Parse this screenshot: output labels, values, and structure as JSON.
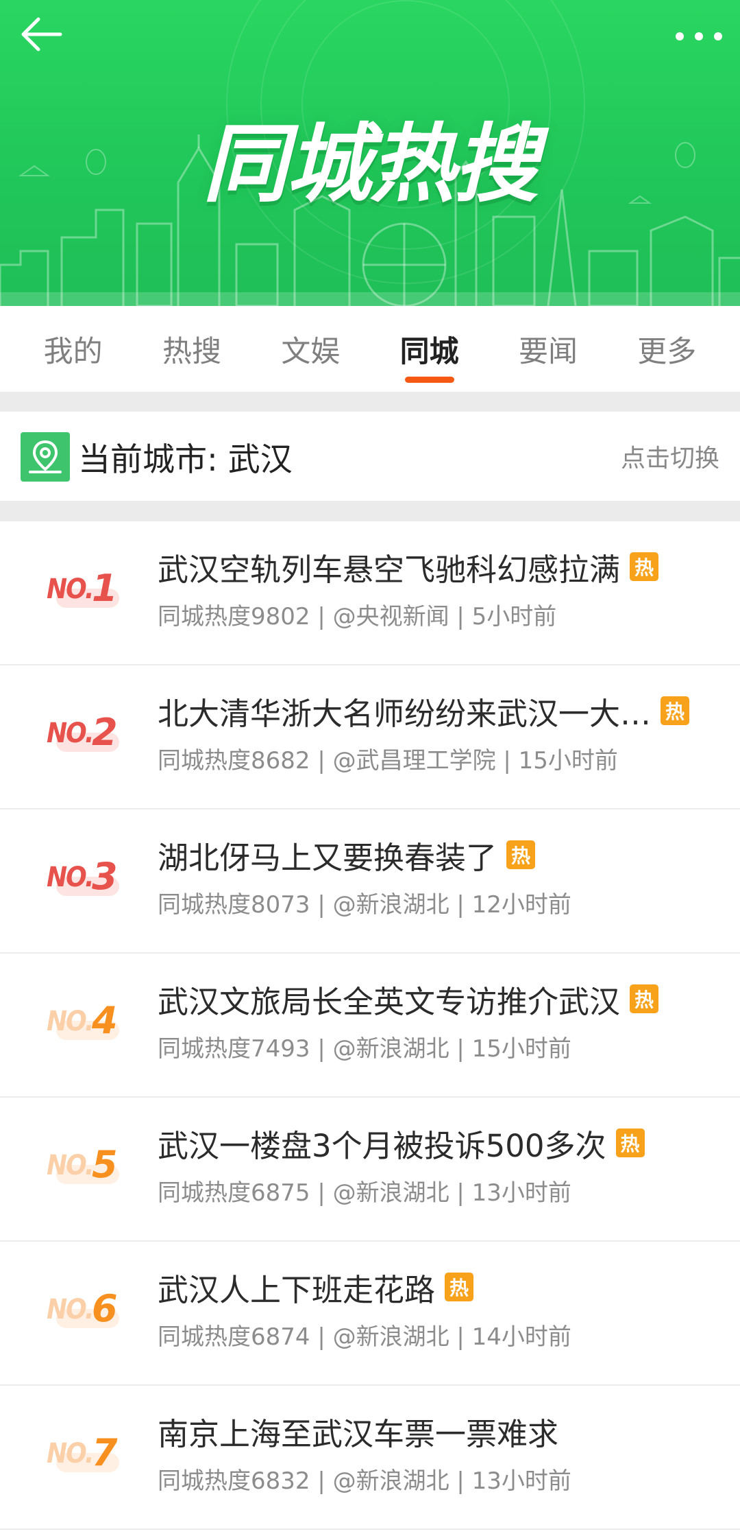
{
  "header": {
    "title": "同城热搜",
    "back_icon": "back-arrow-icon",
    "more_icon": "more-icon"
  },
  "tabs": [
    {
      "label": "我的",
      "active": false
    },
    {
      "label": "热搜",
      "active": false
    },
    {
      "label": "文娱",
      "active": false
    },
    {
      "label": "同城",
      "active": true
    },
    {
      "label": "要闻",
      "active": false
    },
    {
      "label": "更多",
      "active": false
    }
  ],
  "city": {
    "label": "当前城市: 武汉",
    "switch_label": "点击切换",
    "icon": "location-pin-icon"
  },
  "colors": {
    "banner_green": "#22c95a",
    "accent_orange": "#f55914",
    "hot_badge": "#f8a21c",
    "rank_top": "#e8524d",
    "rank_rest": "#f7901e"
  },
  "list": [
    {
      "rank_no": "NO.",
      "rank_num": "1",
      "title": "武汉空轨列车悬空飞驰科幻感拉满",
      "badge": "热",
      "meta": "同城热度9802 | @央视新闻 | 5小时前"
    },
    {
      "rank_no": "NO.",
      "rank_num": "2",
      "title": "北大清华浙大名师纷纷来武汉一大…",
      "badge": "热",
      "meta": "同城热度8682 | @武昌理工学院 | 15小时前"
    },
    {
      "rank_no": "NO.",
      "rank_num": "3",
      "title": "湖北伢马上又要换春装了",
      "badge": "热",
      "meta": "同城热度8073 | @新浪湖北 | 12小时前"
    },
    {
      "rank_no": "NO.",
      "rank_num": "4",
      "title": "武汉文旅局长全英文专访推介武汉",
      "badge": "热",
      "meta": "同城热度7493 | @新浪湖北 | 15小时前"
    },
    {
      "rank_no": "NO.",
      "rank_num": "5",
      "title": "武汉一楼盘3个月被投诉500多次",
      "badge": "热",
      "meta": "同城热度6875 | @新浪湖北 | 13小时前"
    },
    {
      "rank_no": "NO.",
      "rank_num": "6",
      "title": "武汉人上下班走花路",
      "badge": "热",
      "meta": "同城热度6874 | @新浪湖北 | 14小时前"
    },
    {
      "rank_no": "NO.",
      "rank_num": "7",
      "title": "南京上海至武汉车票一票难求",
      "badge": "",
      "meta": "同城热度6832 | @新浪湖北 | 13小时前"
    }
  ]
}
